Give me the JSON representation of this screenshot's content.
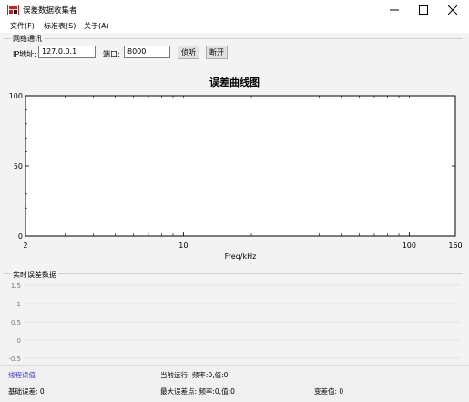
{
  "window": {
    "title": "误差数据收集者"
  },
  "menu": [
    {
      "label": "文件(F)"
    },
    {
      "label": "标准表(S)"
    },
    {
      "label": "关于(A)"
    }
  ],
  "network": {
    "group_title": "网络通讯",
    "ip_label": "IP地址:",
    "ip_value": "127.0.0.1",
    "port_label": "端口:",
    "port_value": "8000",
    "listen_label": "侦听",
    "disconnect_label": "断开"
  },
  "chart_data": [
    {
      "type": "line",
      "title": "误差曲线图",
      "xlabel": "Freq/kHz",
      "ylabel": "",
      "x_scale": "log",
      "xlim": [
        2,
        160
      ],
      "ylim": [
        0,
        100
      ],
      "x_tick_labels": [
        "2",
        "10",
        "100",
        "160"
      ],
      "y_tick_labels": [
        "0",
        "50",
        "100"
      ],
      "series": []
    },
    {
      "type": "line",
      "title": "实时误差数据",
      "ylim": [
        -0.5,
        1.5
      ],
      "y_tick_labels": [
        "1.5",
        "1",
        "0.5",
        "0",
        "-0.5"
      ],
      "series": []
    }
  ],
  "status": {
    "thread_state": "线程读值",
    "current_run": "当前运行: 频率:0,值:0",
    "base_error": "基础误差: 0",
    "max_error": "最大误差点: 频率:0,值:0",
    "variance": "变差值: 0"
  },
  "colors": {
    "thread_state": "#3a3ad0",
    "axis": "#000000",
    "grid": "#e6e6e6"
  }
}
